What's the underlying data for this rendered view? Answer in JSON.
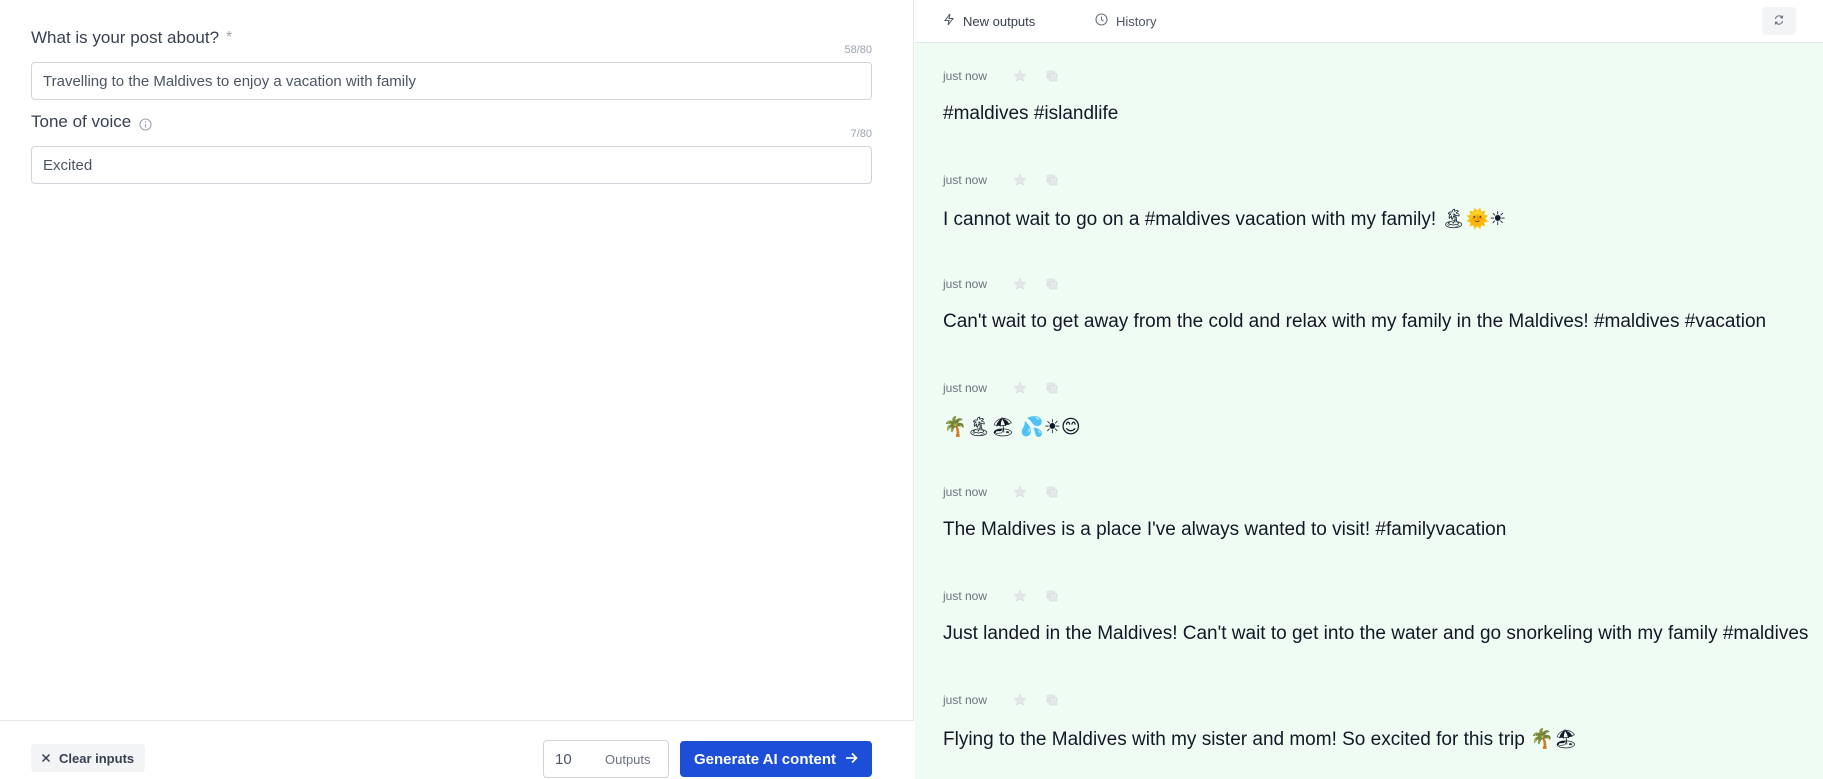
{
  "form": {
    "post_about": {
      "label": "What is your post about?",
      "required_mark": "*",
      "counter": "58/80",
      "value": "Travelling to the Maldives to enjoy a vacation with family"
    },
    "tone": {
      "label": "Tone of voice",
      "counter": "7/80",
      "value": "Excited"
    }
  },
  "bottom": {
    "clear_label": "Clear inputs",
    "outputs_count": "10",
    "outputs_label": "Outputs",
    "generate_label": "Generate AI content"
  },
  "tabs": {
    "new_outputs": "New outputs",
    "history": "History"
  },
  "outputs": [
    {
      "time": "just now",
      "text": "#maldives #islandlife"
    },
    {
      "time": "just now",
      "text": "I cannot wait to go on a #maldives vacation with my family! 🏝🌞☀"
    },
    {
      "time": "just now",
      "text": "Can't wait to get away from the cold and relax with my family in the Maldives! #maldives #vacation"
    },
    {
      "time": "just now",
      "text": "🌴🏝🏖 💦☀😊"
    },
    {
      "time": "just now",
      "text": "The Maldives is a place I've always wanted to visit! #familyvacation"
    },
    {
      "time": "just now",
      "text": "Just landed in the Maldives! Can't wait to get into the water and go snorkeling with my family #maldives"
    },
    {
      "time": "just now",
      "text": "Flying to the Maldives with my sister and mom! So excited for this trip 🌴🏖"
    }
  ],
  "colors": {
    "accent": "#1d4ed8",
    "output_panel_bg": "#effcf3"
  }
}
